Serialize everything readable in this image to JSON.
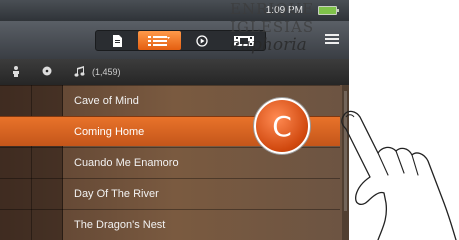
{
  "status": {
    "time": "1:09 PM"
  },
  "toolbar": {
    "tabs": [
      {
        "icon": "document-icon",
        "active": false
      },
      {
        "icon": "list-view-icon",
        "active": true
      },
      {
        "icon": "play-icon",
        "active": false
      },
      {
        "icon": "film-icon",
        "active": false
      }
    ],
    "menu_icon": "menu-icon"
  },
  "header": {
    "columns": [
      "person-icon",
      "disc-icon",
      "music-note-icon"
    ],
    "track_count": "(1,459)"
  },
  "list": {
    "items": [
      {
        "label": "Cave of Mind",
        "selected": false
      },
      {
        "label": "Coming Home",
        "selected": true
      },
      {
        "label": "Cuando Me Enamoro",
        "selected": false
      },
      {
        "label": "Day Of The River",
        "selected": false
      },
      {
        "label": "The Dragon's Nest",
        "selected": false
      }
    ]
  },
  "watermark": {
    "line1": "ENRIQUE",
    "line2": "IGLESIAS",
    "line3": "euphoria"
  },
  "callout": {
    "letter": "C"
  },
  "colors": {
    "accent": "#e8732a",
    "battery": "#7fc24a"
  }
}
